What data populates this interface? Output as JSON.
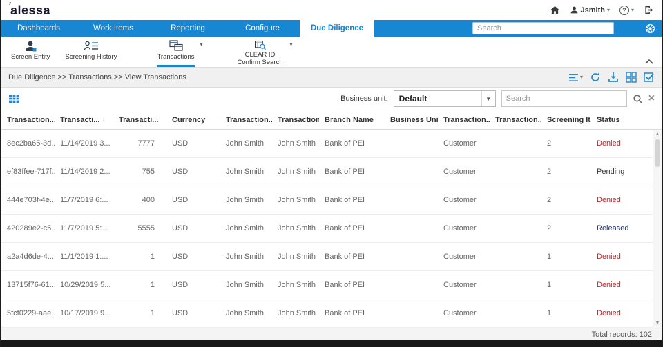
{
  "app": {
    "name": "alessa",
    "logo_mark": "’"
  },
  "top_bar": {
    "user": "Jsmith"
  },
  "icons": {
    "caret_down": "▾",
    "dropdown_caret": "▼",
    "help": "?",
    "clear": "×",
    "sort_desc": "↓",
    "scroll_up": "▲",
    "scroll_down": "▼"
  },
  "colors": {
    "accent_blue": "#1787d4",
    "icon_blue": "#1e88d2",
    "icon_navy": "#2c3e50"
  },
  "nav": {
    "items": [
      "Dashboards",
      "Work Items",
      "Reporting",
      "Configure",
      "Due Diligence"
    ],
    "active_item": "Due Diligence",
    "search_placeholder": "Search"
  },
  "ribbon": {
    "items": [
      {
        "label": "Screen Entity"
      },
      {
        "label": "Screening History"
      },
      {
        "label": "Transactions",
        "active": true,
        "has_dropdown": true
      },
      {
        "label": "CLEAR ID Confirm Search",
        "has_dropdown": true
      }
    ]
  },
  "breadcrumb": "Due Diligence >> Transactions >> View Transactions",
  "filter": {
    "business_unit_label": "Business unit:",
    "business_unit_value": "Default",
    "search_placeholder": "Search"
  },
  "table": {
    "columns": [
      {
        "label": "Transaction..."
      },
      {
        "label": "Transacti...",
        "sorted": "desc"
      },
      {
        "label": "Transacti..."
      },
      {
        "label": "Currency"
      },
      {
        "label": "Transaction..."
      },
      {
        "label": "Transaction..."
      },
      {
        "label": "Branch Name"
      },
      {
        "label": "Business Unit"
      },
      {
        "label": "Transaction..."
      },
      {
        "label": "Transaction..."
      },
      {
        "label": "Screening It..."
      },
      {
        "label": "Status"
      }
    ],
    "rows": [
      [
        "8ec2ba65-3d...",
        "11/14/2019 3...",
        "7777",
        "USD",
        "John Smith",
        "John Smith",
        "Bank of PEI",
        "",
        "Customer",
        "",
        "2",
        "Denied"
      ],
      [
        "ef83ffee-717f...",
        "11/14/2019 2...",
        "755",
        "USD",
        "John Smith",
        "John Smith",
        "Bank of PEI",
        "",
        "Customer",
        "",
        "2",
        "Pending"
      ],
      [
        "444e703f-4e...",
        "11/7/2019 6:...",
        "400",
        "USD",
        "John Smith",
        "John Smith",
        "Bank of PEI",
        "",
        "Customer",
        "",
        "2",
        "Denied"
      ],
      [
        "420289e2-c5...",
        "11/7/2019 5:...",
        "5555",
        "USD",
        "John Smith",
        "John Smith",
        "Bank of PEI",
        "",
        "Customer",
        "",
        "2",
        "Released"
      ],
      [
        "a2a4d6de-4...",
        "11/1/2019 1:...",
        "1",
        "USD",
        "John Smith",
        "John Smith",
        "Bank of PEI",
        "",
        "Customer",
        "",
        "1",
        "Denied"
      ],
      [
        "13715f76-61...",
        "10/29/2019 5...",
        "1",
        "USD",
        "John Smith",
        "John Smith",
        "Bank of PEI",
        "",
        "Customer",
        "",
        "1",
        "Denied"
      ],
      [
        "5fcf0229-aae...",
        "10/17/2019 9...",
        "1",
        "USD",
        "John Smith",
        "John Smith",
        "Bank of PEI",
        "",
        "Customer",
        "",
        "1",
        "Denied"
      ]
    ],
    "status_colors": {
      "Denied": "#cb2128",
      "Pending": "#3a3a3a",
      "Released": "#20316b"
    }
  },
  "footer": {
    "total_records_label": "Total records:",
    "total_records_value": "102"
  }
}
